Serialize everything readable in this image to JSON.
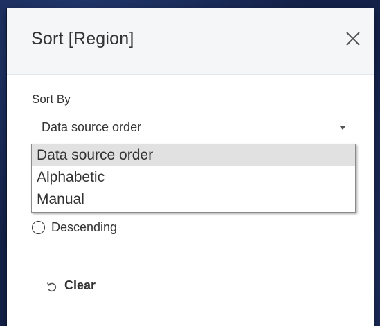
{
  "dialog": {
    "title": "Sort [Region]",
    "close_icon": "close-icon"
  },
  "sort_by": {
    "label": "Sort By",
    "selected_value": "Data source order",
    "options": [
      {
        "label": "Data source order",
        "selected": true
      },
      {
        "label": "Alphabetic",
        "selected": false
      },
      {
        "label": "Manual",
        "selected": false
      }
    ]
  },
  "sort_order": {
    "descending_label": "Descending"
  },
  "clear": {
    "icon": "undo-icon",
    "label": "Clear"
  },
  "colors": {
    "background": "#14224a",
    "header": "#f4f6f8",
    "text": "#333333",
    "selected_option": "#e1e1e1"
  }
}
